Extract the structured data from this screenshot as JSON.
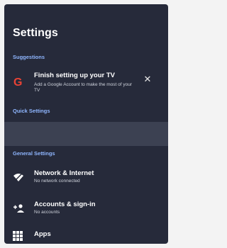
{
  "header": {
    "title": "Settings"
  },
  "suggestions": {
    "header": "Suggestions",
    "item": {
      "icon": "google-g-icon",
      "title": "Finish setting up your TV",
      "subtitle": "Add a Google Account to make the most of your TV",
      "dismiss_icon": "close-icon"
    }
  },
  "quick_settings": {
    "header": "Quick Settings"
  },
  "general_settings": {
    "header": "General Settings",
    "items": [
      {
        "icon": "wifi-off-icon",
        "label": "Network & Internet",
        "sublabel": "No network connected"
      },
      {
        "icon": "add-account-icon",
        "label": "Accounts & sign-in",
        "sublabel": "No accounts"
      },
      {
        "icon": "apps-grid-icon",
        "label": "Apps"
      }
    ]
  },
  "colors": {
    "panel_bg": "#262a3a",
    "accent": "#8fb6ff",
    "highlight_band": "#3c4152",
    "text": "#ffffff"
  }
}
